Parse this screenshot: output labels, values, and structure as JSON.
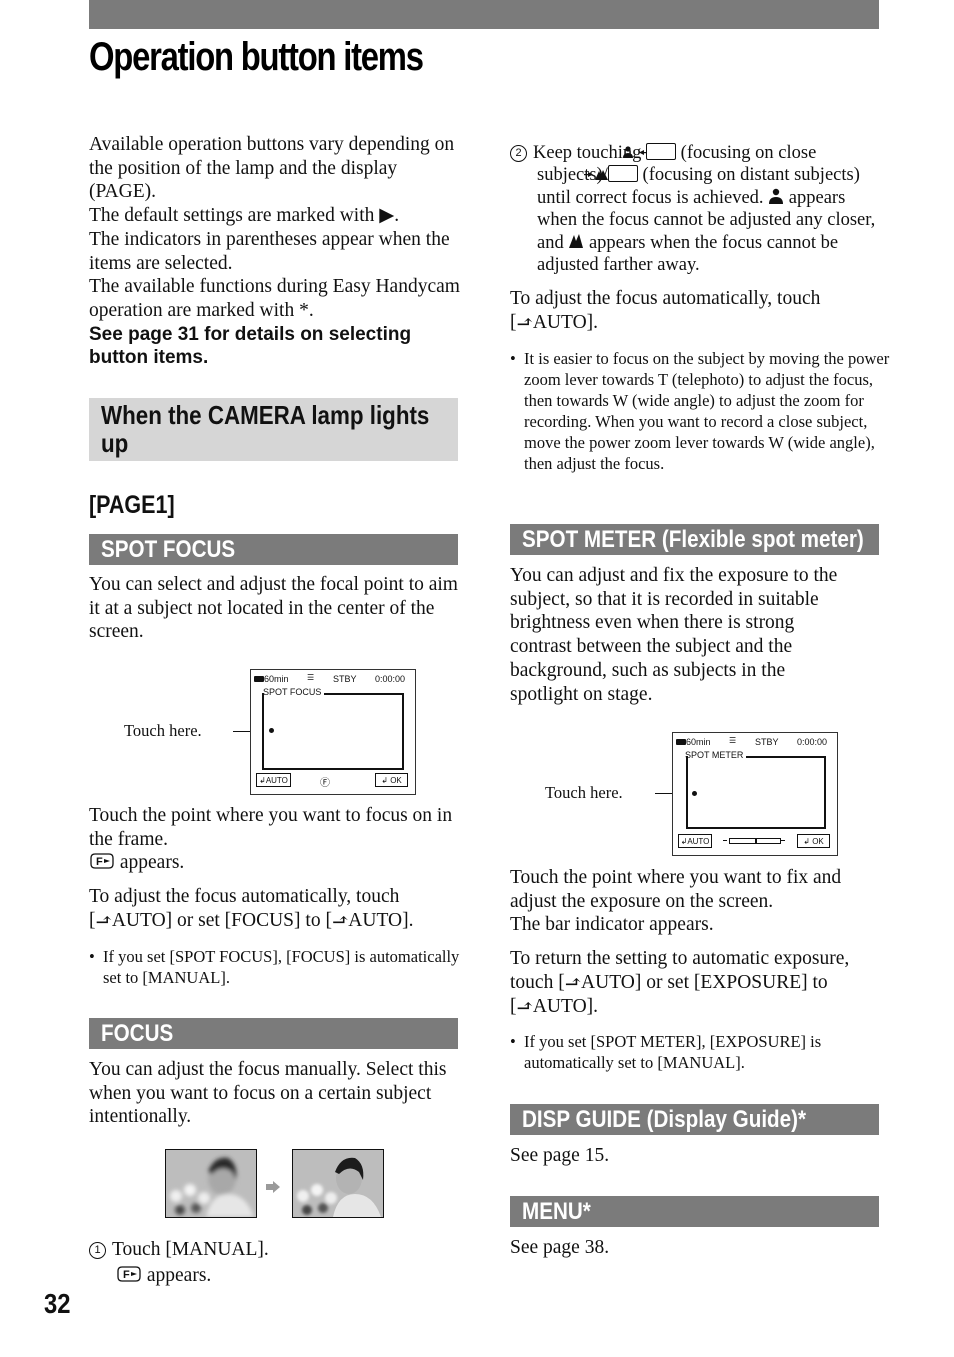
{
  "page": {
    "title": "Operation button items",
    "page_number": "32"
  },
  "intro": {
    "paragraphs": [
      "Available operation buttons vary depending on the position of the lamp and the display (PAGE).",
      "The default settings are marked with ▶.",
      "The indicators in parentheses appear when the items are selected.",
      "The available functions during Easy Handycam operation are marked with *."
    ],
    "bold_note": "See page 31 for details on selecting button items."
  },
  "camera_section": {
    "heading": "When the CAMERA lamp lights up",
    "page_label": "[PAGE1]"
  },
  "spot_focus": {
    "heading": "SPOT FOCUS",
    "description": "You can select and adjust the focal point to aim it at a subject not located in the center of the screen.",
    "callout": "Touch here.",
    "lcd": {
      "battery": "60min",
      "status": "STBY",
      "timecode": "0:00:00",
      "frame_label": "SPOT  FOCUS",
      "auto_button": "AUTO",
      "ok_button": "OK"
    },
    "instruction_1": "Touch the point where you want to focus on in the frame.",
    "instruction_2": "appears.",
    "auto_text_a": "To adjust the focus automatically, touch [",
    "auto_text_b": "AUTO] or set [FOCUS] to [",
    "auto_text_c": "AUTO].",
    "note": "If you set [SPOT FOCUS], [FOCUS] is automatically set to [MANUAL]."
  },
  "focus": {
    "heading": "FOCUS",
    "description": "You can adjust the focus manually. Select this when you want to focus on a certain subject intentionally.",
    "step1_number": "1",
    "step1": "Touch [MANUAL].",
    "step1_sub": "appears.",
    "step2_number": "2",
    "step2_a": "Keep touching",
    "step2_b": "(focusing on close subjects)/",
    "step2_c": "(focusing on distant subjects) until correct focus is achieved.",
    "step2_d": "appears when the focus cannot be adjusted any closer, and",
    "step2_e": "appears when the focus cannot be adjusted farther away.",
    "auto_text_a": "To adjust the focus automatically, touch [",
    "auto_text_b": "AUTO].",
    "note": "It is easier to focus on the subject by moving the power zoom lever towards T (telephoto) to adjust the focus, then towards W (wide angle) to adjust the zoom for recording. When you want to record a close subject, move the power zoom lever towards W (wide angle), then adjust the focus."
  },
  "spot_meter": {
    "heading": "SPOT METER (Flexible spot meter)",
    "description": "You can adjust and fix the exposure to the subject, so that it is recorded in suitable brightness even when there is strong contrast between the subject and the background, such as subjects in the spotlight on stage.",
    "callout": "Touch here.",
    "lcd": {
      "battery": "60min",
      "status": "STBY",
      "timecode": "0:00:00",
      "frame_label": "SPOT  METER",
      "auto_button": "AUTO",
      "ok_button": "OK",
      "bar_level": 0.5
    },
    "instruction_1": "Touch the point where you want to fix and adjust the exposure on the screen.",
    "instruction_2": "The bar indicator appears.",
    "return_a": "To return the setting to automatic exposure, touch [",
    "return_b": "AUTO] or set [EXPOSURE] to [",
    "return_c": "AUTO].",
    "note": "If you set [SPOT METER], [EXPOSURE] is automatically set to [MANUAL]."
  },
  "disp_guide": {
    "heading": "DISP GUIDE (Display Guide)*",
    "text": "See page 15."
  },
  "menu": {
    "heading": "MENU*",
    "text": "See page 38."
  },
  "colors": {
    "section_bar": "#7b7b7b",
    "subhead_bg": "#d6d6d6",
    "text": "#111111"
  }
}
